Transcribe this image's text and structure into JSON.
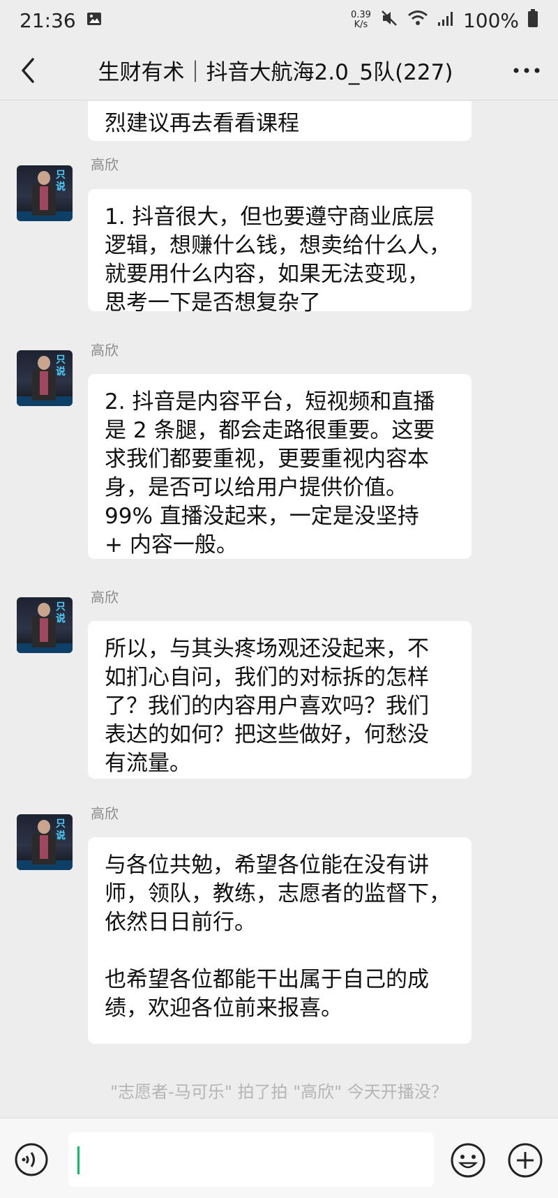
{
  "status_bar": {
    "time": "21:36",
    "net_speed_value": "0.39",
    "net_speed_unit": "K/s",
    "battery": "100%"
  },
  "header": {
    "title": "生财有术｜抖音大航海2.0_5队(227)"
  },
  "messages": [
    {
      "sender": "",
      "text": "烈建议再去看看课程"
    },
    {
      "sender": "高欣",
      "text": "1. 抖音很大，但也要遵守商业底层\n逻辑，想赚什么钱，想卖给什么人，\n就要用什么内容，如果无法变现，\n思考一下是否想复杂了"
    },
    {
      "sender": "高欣",
      "text": "2. 抖音是内容平台，短视频和直播\n是 2 条腿，都会走路很重要。这要\n求我们都要重视，更要重视内容本\n身，是否可以给用户提供价值。\n99% 直播没起来，一定是没坚持\n+ 内容一般。"
    },
    {
      "sender": "高欣",
      "text": "所以，与其头疼场观还没起来，不\n如扪心自问，我们的对标拆的怎样\n了？我们的内容用户喜欢吗？我们\n表达的如何？把这些做好，何愁没\n有流量。"
    },
    {
      "sender": "高欣",
      "text": "与各位共勉，希望各位能在没有讲\n师，领队，教练，志愿者的监督下，\n依然日日前行。\n\n也希望各位都能干出属于自己的成\n绩，欢迎各位前来报喜。"
    }
  ],
  "system_message": "\"志愿者-马可乐\" 拍了拍 \"高欣\" 今天开播没？",
  "avatar_overlay_text": "只说",
  "colors": {
    "background": "#ededed",
    "bubble": "#ffffff",
    "caret": "#07c160"
  }
}
